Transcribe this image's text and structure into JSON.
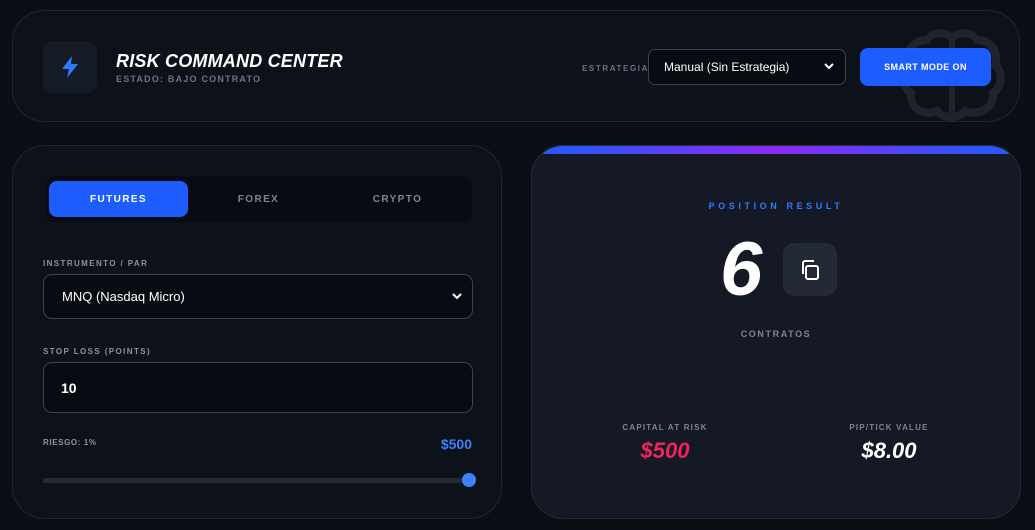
{
  "header": {
    "title": "RISK COMMAND CENTER",
    "subtitle": "ESTADO: BAJO CONTRATO",
    "strategy_label": "ESTRATEGIA",
    "strategy_value": "Manual (Sin Estrategia)",
    "smart_mode_label": "SMART MODE ON"
  },
  "left": {
    "tabs": [
      {
        "label": "FUTURES",
        "active": true
      },
      {
        "label": "FOREX",
        "active": false
      },
      {
        "label": "CRYPTO",
        "active": false
      }
    ],
    "instrument_label": "INSTRUMENTO / PAR",
    "instrument_value": "MNQ (Nasdaq Micro)",
    "stop_loss_label": "STOP LOSS (POINTS)",
    "stop_loss_value": "10",
    "risk_label": "RIESGO: 1%",
    "risk_amount": "$500",
    "risk_slider_fraction": 1.0
  },
  "result": {
    "title": "POSITION RESULT",
    "contracts": "6",
    "contracts_label": "CONTRATOS",
    "capital_label": "CAPITAL AT RISK",
    "capital_value": "$500",
    "pip_label": "PIP/TICK VALUE",
    "pip_value": "$8.00"
  },
  "colors": {
    "accent": "#1d5cff",
    "accent_text": "#3b82ff",
    "danger": "#f0245a",
    "gradient_mid": "#8b2cf5"
  },
  "icons": {
    "logo": "lightning-icon",
    "copy": "copy-icon",
    "watermark": "brain-icon",
    "dropdown": "chevron-down-icon"
  }
}
